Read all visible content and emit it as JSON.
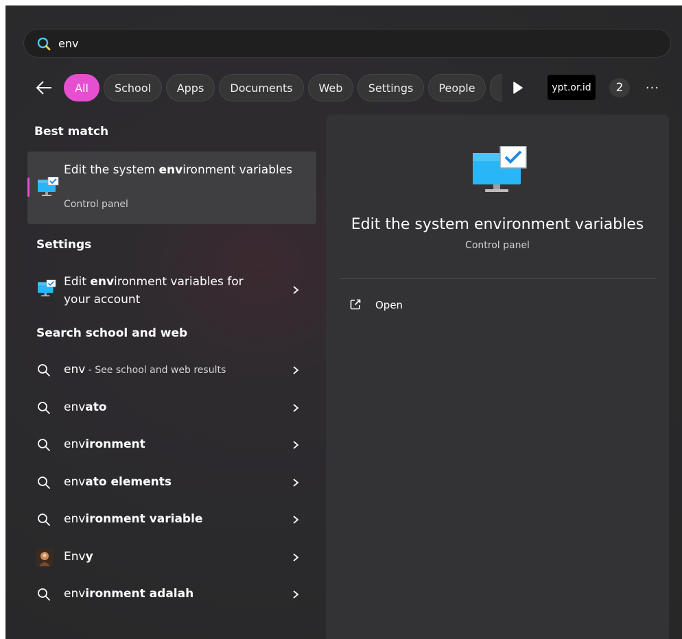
{
  "search": {
    "value": "env",
    "placeholder": ""
  },
  "filters": {
    "chips": [
      "All",
      "School",
      "Apps",
      "Documents",
      "Web",
      "Settings",
      "People"
    ],
    "active": "All",
    "org": "ypt.or.id",
    "count": "2",
    "more": "···"
  },
  "sections": {
    "best_match": "Best match",
    "settings": "Settings",
    "search_web": "Search school and web"
  },
  "best_match": {
    "title_pre": "Edit the system ",
    "title_bold": "env",
    "title_post": "ironment variables",
    "subtitle": "Control panel"
  },
  "settings_item": {
    "pre": "Edit ",
    "bold": "env",
    "post": "ironment variables for your account"
  },
  "web_results": [
    {
      "typed": "env",
      "rest": "",
      "suffix": " - See school and web results",
      "icon": "search-icon"
    },
    {
      "typed": "env",
      "rest": "ato",
      "suffix": "",
      "icon": "search-icon"
    },
    {
      "typed": "env",
      "rest": "ironment",
      "suffix": "",
      "icon": "search-icon"
    },
    {
      "typed": "env",
      "rest": "ato elements",
      "suffix": "",
      "icon": "search-icon"
    },
    {
      "typed": "env",
      "rest": "ironment variable",
      "suffix": "",
      "icon": "search-icon"
    },
    {
      "typed": "Env",
      "rest": "y",
      "suffix": "",
      "icon": "app-thumbnail-icon"
    },
    {
      "typed": "env",
      "rest": "ironment adalah",
      "suffix": "",
      "icon": "search-icon"
    }
  ],
  "preview": {
    "title": "Edit the system environment variables",
    "subtitle": "Control panel",
    "open_label": "Open"
  },
  "colors": {
    "accent": "#e64fd0",
    "panel": "#2a2a2c",
    "preview": "#333335"
  }
}
